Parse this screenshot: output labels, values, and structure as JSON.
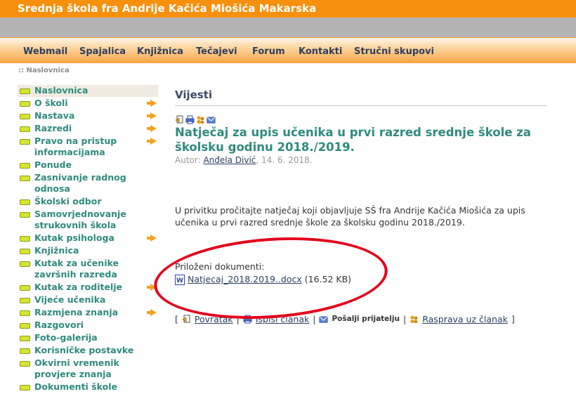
{
  "header": {
    "site_title": "Srednja škola fra Andrije Kačića Miošića Makarska"
  },
  "nav": [
    "Webmail",
    "Spajalica",
    "Knjižnica",
    "Tečajevi",
    "Forum",
    "Kontakti",
    "Stručni skupovi"
  ],
  "breadcrumb": ":: Naslovnica",
  "sidebar": {
    "items": [
      {
        "label": "Naslovnica",
        "arrow": false
      },
      {
        "label": "O školi",
        "arrow": true
      },
      {
        "label": "Nastava",
        "arrow": true
      },
      {
        "label": "Razredi",
        "arrow": true
      },
      {
        "label": "Pravo na pristup informacijama",
        "arrow": true
      },
      {
        "label": "Ponude",
        "arrow": false
      },
      {
        "label": "Zasnivanje radnog odnosa",
        "arrow": false
      },
      {
        "label": "Školski odbor",
        "arrow": false
      },
      {
        "label": "Samovrjednovanje strukovnih škola",
        "arrow": false
      },
      {
        "label": "Kutak psihologa",
        "arrow": true
      },
      {
        "label": "Knjižnica",
        "arrow": false
      },
      {
        "label": "Kutak za učenike završnih razreda",
        "arrow": false
      },
      {
        "label": "Kutak za roditelje",
        "arrow": true
      },
      {
        "label": "Vijeće učenika",
        "arrow": false
      },
      {
        "label": "Razmjena znanja",
        "arrow": true
      },
      {
        "label": "Razgovori",
        "arrow": false
      },
      {
        "label": "Foto-galerija",
        "arrow": false
      },
      {
        "label": "Korisničke postavke",
        "arrow": false
      },
      {
        "label": "Okvirni vremenik provjere znanja",
        "arrow": false
      },
      {
        "label": "Dokumenti škole",
        "arrow": false
      }
    ]
  },
  "main": {
    "section_title": "Vijesti",
    "article_title": "Natječaj za upis učenika u prvi razred srednje škole za školsku godinu 2018./2019.",
    "meta_prefix": "Autor:",
    "author": "Anđela Divić",
    "meta_date": ", 14. 6. 2018.",
    "body": "U privitku pročitajte natječaj koji objavljuje SŠ fra Andrije Kačića Miošića za upis učenika u prvi razred srednje škole za školsku godinu 2018./2019.",
    "attachments_label": "Priloženi dokumenti:",
    "attachment_name": "Natjecaj_2018.2019..docx",
    "attachment_size": "(16.52 KB)",
    "actions": {
      "open": "[",
      "back": "Povratak",
      "print": "Ispiši članak",
      "send": "Pošalji prijatelju",
      "discuss": "Rasprava uz članak",
      "close": "]",
      "sep": "|"
    }
  },
  "colors": {
    "header_orange": "#f7900d",
    "link_teal": "#2f8a7e",
    "nav_text": "#2b3f63",
    "annotation_red": "#e3001b"
  }
}
